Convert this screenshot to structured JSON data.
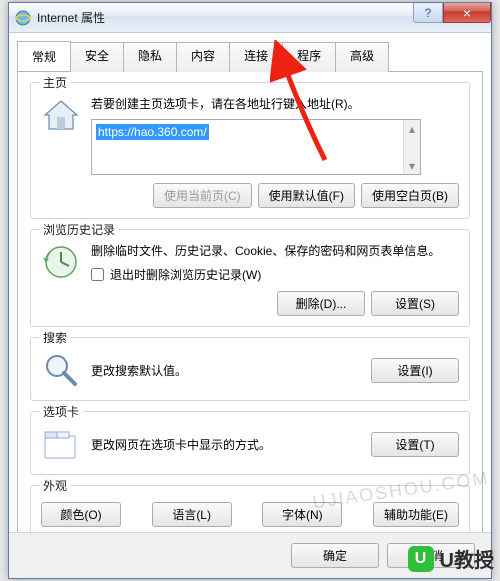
{
  "window": {
    "title": "Internet 属性",
    "help_glyph": "?",
    "close_glyph": "×"
  },
  "tabs": [
    "常规",
    "安全",
    "隐私",
    "内容",
    "连接",
    "程序",
    "高级"
  ],
  "active_tab_index": 0,
  "homepage": {
    "heading": "主页",
    "desc": "若要创建主页选项卡，请在各地址行键入地址(R)。",
    "url_value": "https://hao.360.com/",
    "buttons": {
      "use_current": "使用当前页(C)",
      "use_default": "使用默认值(F)",
      "use_blank": "使用空白页(B)"
    }
  },
  "history": {
    "heading": "浏览历史记录",
    "desc": "删除临时文件、历史记录、Cookie、保存的密码和网页表单信息。",
    "checkbox_label": "退出时删除浏览历史记录(W)",
    "delete_btn": "删除(D)...",
    "settings_btn": "设置(S)"
  },
  "search": {
    "heading": "搜索",
    "desc": "更改搜索默认值。",
    "settings_btn": "设置(I)"
  },
  "tabset": {
    "heading": "选项卡",
    "desc": "更改网页在选项卡中显示的方式。",
    "settings_btn": "设置(T)"
  },
  "appearance": {
    "heading": "外观",
    "color_btn": "颜色(O)",
    "language_btn": "语言(L)",
    "font_btn": "字体(N)",
    "a11y_btn": "辅助功能(E)"
  },
  "footer": {
    "ok": "确定",
    "cancel": "取消"
  },
  "watermarks": {
    "text1": "UJIAOSHOU.COM",
    "badge": "U",
    "text2": "U教授"
  }
}
